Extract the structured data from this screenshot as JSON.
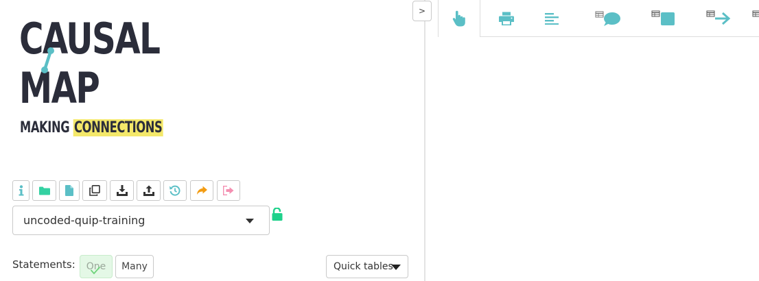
{
  "logo": {
    "line1": "CAUSAL",
    "line2": "MAP",
    "tagline_plain": "MAKING ",
    "tagline_highlight": "CONNECTIONS"
  },
  "toolbar": {
    "buttons": [
      {
        "icon": "info-icon",
        "color": "#5bbfc6"
      },
      {
        "icon": "folder-icon",
        "color": "#34d1a2"
      },
      {
        "icon": "file-icon",
        "color": "#5bbfc6"
      },
      {
        "icon": "copy-icon",
        "color": "#333333"
      },
      {
        "icon": "download-icon",
        "color": "#333333"
      },
      {
        "icon": "upload-icon",
        "color": "#333333"
      },
      {
        "icon": "history-icon",
        "color": "#5bbfc6"
      },
      {
        "icon": "share-icon",
        "color": "#f39c12"
      },
      {
        "icon": "sign-out-icon",
        "color": "#f48fb1"
      }
    ]
  },
  "file_select": {
    "value": "uncoded-quip-training"
  },
  "lock": {
    "icon": "unlock-icon",
    "color": "#1fd18b"
  },
  "statements": {
    "label": "Statements:",
    "one": "One",
    "many": "Many"
  },
  "quick_tables": {
    "label": "Quick tables"
  },
  "collapse": {
    "label": ">"
  },
  "tabs": [
    {
      "icon": "pointer-hand-icon"
    },
    {
      "icon": "print-icon"
    },
    {
      "icon": "align-left-icon"
    },
    {
      "icon": "table-comment-icon"
    },
    {
      "icon": "table-square-icon"
    },
    {
      "icon": "table-arrow-icon"
    },
    {
      "icon": "table-icon"
    }
  ],
  "colors": {
    "accent": "#5bbfc6",
    "logo_dark": "#2b2d3a",
    "logo_highlight": "#f4e86a"
  }
}
